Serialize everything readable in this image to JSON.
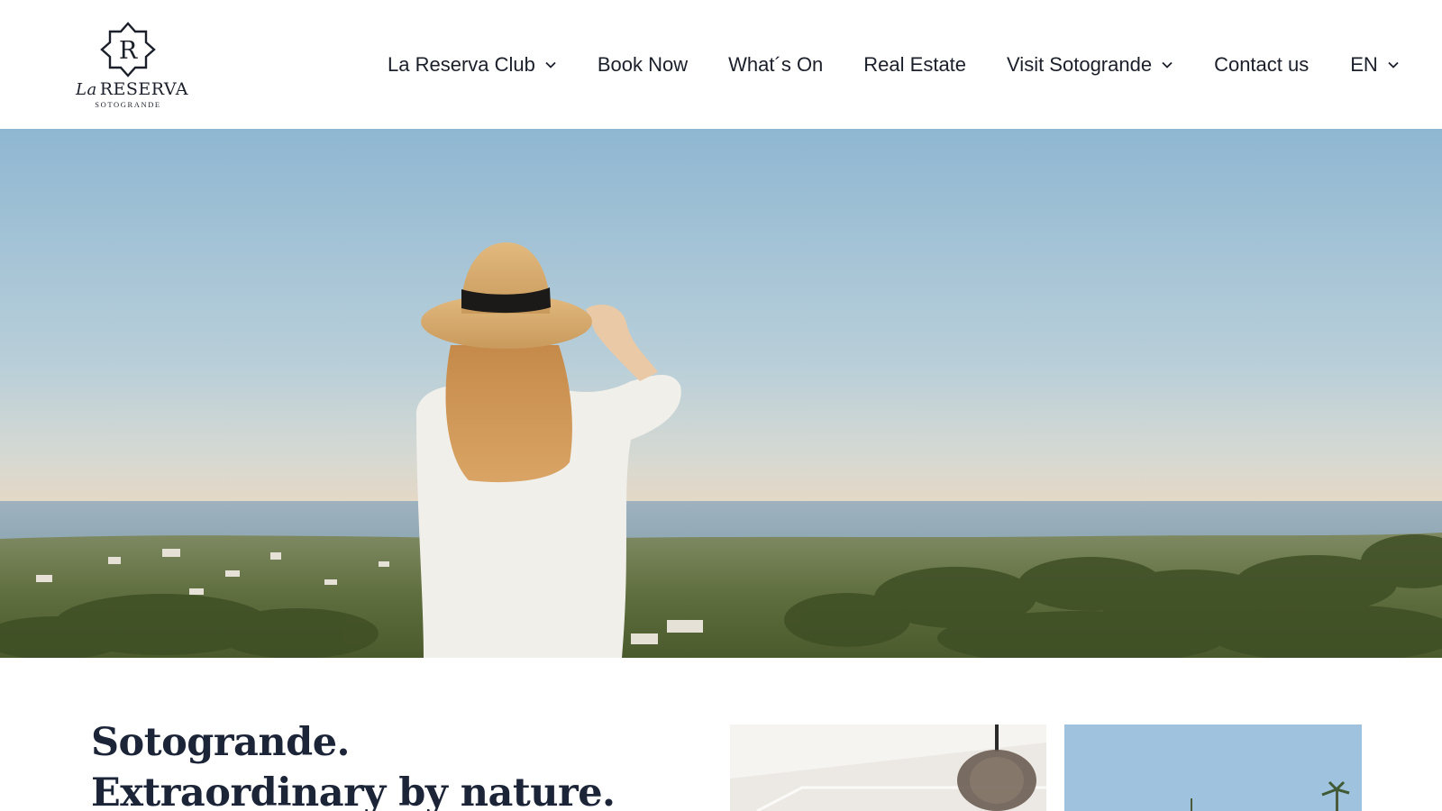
{
  "brand": {
    "monogram": "R",
    "name_prefix": "La",
    "name": "RESERVA",
    "subtitle": "SOTOGRANDE"
  },
  "nav": {
    "items": [
      {
        "label": "La Reserva Club",
        "has_dropdown": true
      },
      {
        "label": "Book Now",
        "has_dropdown": false
      },
      {
        "label": "What´s On",
        "has_dropdown": false
      },
      {
        "label": "Real Estate",
        "has_dropdown": false
      },
      {
        "label": "Visit Sotogrande",
        "has_dropdown": true
      },
      {
        "label": "Contact us",
        "has_dropdown": false
      }
    ],
    "language": {
      "label": "EN",
      "has_dropdown": true
    }
  },
  "hero": {
    "image": "woman-in-straw-hat-overlooking-sotogrande-coast"
  },
  "intro": {
    "headline_line1": "Sotogrande.",
    "headline_line2": "Extraordinary by nature."
  },
  "thumbnails": [
    {
      "image": "interior-with-pendant-lamp"
    },
    {
      "image": "sky-with-palm-tree"
    }
  ],
  "colors": {
    "text": "#1b1f2a",
    "headline": "#1c2438",
    "background": "#ffffff"
  }
}
